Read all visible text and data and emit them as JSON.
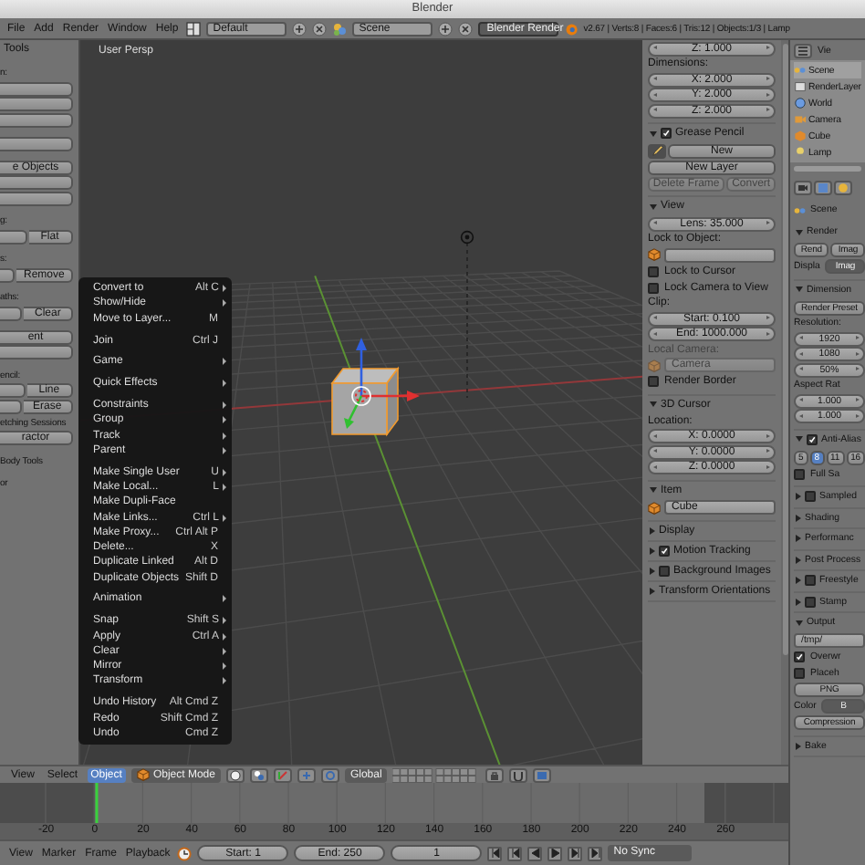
{
  "window": {
    "title": "Blender"
  },
  "menubar": {
    "menus": [
      "File",
      "Add",
      "Render",
      "Window",
      "Help"
    ],
    "layout": "Default",
    "scene": "Scene",
    "engine": "Blender Render",
    "stats": "v2.67 | Verts:8 | Faces:6 | Tris:12 | Objects:1/3 | Lamp"
  },
  "tool_shelf": {
    "title": "Tools",
    "groups": [
      {
        "items": [
          {
            "kind": "label",
            "label": "n:"
          },
          {
            "kind": "button"
          },
          {
            "kind": "button"
          },
          {
            "kind": "button"
          }
        ]
      },
      {
        "items": [
          {
            "kind": "button"
          }
        ]
      },
      {
        "items": [
          {
            "kind": "button",
            "label": "e Objects"
          },
          {
            "kind": "button"
          },
          {
            "kind": "button"
          }
        ]
      },
      {
        "items": [
          {
            "kind": "label",
            "label": "g:"
          },
          {
            "kind": "pair",
            "label": "Flat"
          }
        ]
      },
      {
        "items": [
          {
            "kind": "label",
            "label": "s:"
          },
          {
            "kind": "pair",
            "label": "Remove"
          }
        ]
      },
      {
        "items": [
          {
            "kind": "label",
            "label": "aths:"
          },
          {
            "kind": "pair",
            "label": "Clear"
          }
        ]
      },
      {
        "items": [
          {
            "kind": "button",
            "label": "ent"
          },
          {
            "kind": "button"
          }
        ]
      },
      {
        "items": [
          {
            "kind": "label",
            "label": "encil:"
          },
          {
            "kind": "pair",
            "label": "Line"
          },
          {
            "kind": "pair",
            "label": "Erase"
          },
          {
            "kind": "label",
            "label": "etching Sessions"
          },
          {
            "kind": "button",
            "label": "ractor"
          }
        ]
      },
      {
        "items": [
          {
            "kind": "label",
            "label": "Body Tools"
          }
        ]
      },
      {
        "items": [
          {
            "kind": "label",
            "label": "or"
          }
        ]
      }
    ]
  },
  "viewport": {
    "label": "User Persp"
  },
  "object_menu": {
    "sections": [
      [
        {
          "label": "Convert to",
          "shortcut": "Alt C",
          "submenu": true
        },
        {
          "label": "Show/Hide",
          "submenu": true
        },
        {
          "label": "Move to Layer...",
          "shortcut": "M",
          "submenu": false
        }
      ],
      [
        {
          "label": "Join",
          "shortcut": "Ctrl J",
          "submenu": false
        }
      ],
      [
        {
          "label": "Game",
          "submenu": true
        }
      ],
      [
        {
          "label": "Quick Effects",
          "submenu": true
        }
      ],
      [
        {
          "label": "Constraints",
          "submenu": true
        },
        {
          "label": "Group",
          "submenu": true
        },
        {
          "label": "Track",
          "submenu": true
        },
        {
          "label": "Parent",
          "submenu": true
        }
      ],
      [
        {
          "label": "Make Single User",
          "shortcut": "U",
          "submenu": true
        },
        {
          "label": "Make Local...",
          "shortcut": "L",
          "submenu": true
        },
        {
          "label": "Make Dupli-Face",
          "submenu": false
        },
        {
          "label": "Make Links...",
          "shortcut": "Ctrl L",
          "submenu": true
        },
        {
          "label": "Make Proxy...",
          "shortcut": "Ctrl Alt P",
          "submenu": false
        },
        {
          "label": "Delete...",
          "shortcut": "X",
          "submenu": false
        },
        {
          "label": "Duplicate Linked",
          "shortcut": "Alt D",
          "submenu": false
        },
        {
          "label": "Duplicate Objects",
          "shortcut": "Shift D",
          "submenu": false
        }
      ],
      [
        {
          "label": "Animation",
          "submenu": true
        }
      ],
      [
        {
          "label": "Snap",
          "shortcut": "Shift S",
          "submenu": true
        },
        {
          "label": "Apply",
          "shortcut": "Ctrl A",
          "submenu": true
        },
        {
          "label": "Clear",
          "submenu": true
        },
        {
          "label": "Mirror",
          "submenu": true
        },
        {
          "label": "Transform",
          "submenu": true
        }
      ],
      [
        {
          "label": "Undo History",
          "shortcut": "Alt Cmd Z",
          "submenu": false
        },
        {
          "label": "Redo",
          "shortcut": "Shift Cmd Z",
          "submenu": false
        },
        {
          "label": "Undo",
          "shortcut": "Cmd Z",
          "submenu": false
        }
      ]
    ]
  },
  "n_panel": {
    "panels": [
      {
        "items": [
          {
            "kind": "field",
            "value": "Z: 1.000"
          },
          {
            "kind": "label",
            "label": "Dimensions:"
          },
          {
            "kind": "field",
            "value": "X: 2.000"
          },
          {
            "kind": "field",
            "value": "Y: 2.000"
          },
          {
            "kind": "field",
            "value": "Z: 2.000"
          }
        ]
      },
      {
        "header": {
          "label": "Grease Pencil",
          "expanded": true,
          "checked": true
        },
        "items": [
          {
            "kind": "iconbutton",
            "label": "New"
          },
          {
            "kind": "button",
            "label": "New Layer"
          },
          {
            "kind": "buttons",
            "buttons": [
              {
                "label": "Delete Frame",
                "disabled": true
              },
              {
                "label": "Convert",
                "disabled": true
              }
            ]
          }
        ]
      },
      {
        "header": {
          "label": "View",
          "expanded": true
        },
        "items": [
          {
            "kind": "field",
            "value": "Lens: 35.000"
          },
          {
            "kind": "label",
            "label": "Lock to Object:"
          },
          {
            "kind": "object"
          },
          {
            "kind": "check",
            "label": "Lock to Cursor",
            "checked": false
          },
          {
            "kind": "check",
            "label": "Lock Camera to View",
            "checked": false
          },
          {
            "kind": "label",
            "label": "Clip:"
          },
          {
            "kind": "field",
            "value": "Start: 0.100"
          },
          {
            "kind": "field",
            "value": "End: 1000.000"
          },
          {
            "kind": "label",
            "label": "Local Camera:",
            "disabled": true
          },
          {
            "kind": "object",
            "value": "Camera",
            "disabled": true
          },
          {
            "kind": "check",
            "label": "Render Border",
            "checked": false
          }
        ]
      },
      {
        "header": {
          "label": "3D Cursor",
          "expanded": true
        },
        "items": [
          {
            "kind": "label",
            "label": "Location:"
          },
          {
            "kind": "field",
            "value": "X: 0.0000"
          },
          {
            "kind": "field",
            "value": "Y: 0.0000"
          },
          {
            "kind": "field",
            "value": "Z: 0.0000"
          }
        ]
      },
      {
        "header": {
          "label": "Item",
          "expanded": true
        },
        "items": [
          {
            "kind": "object",
            "value": "Cube"
          }
        ]
      },
      {
        "header": {
          "label": "Display",
          "expanded": false
        }
      },
      {
        "header": {
          "label": "Motion Tracking",
          "expanded": false,
          "checked": true
        }
      },
      {
        "header": {
          "label": "Background Images",
          "expanded": false,
          "checked": false
        }
      },
      {
        "header": {
          "label": "Transform Orientations",
          "expanded": false
        }
      }
    ]
  },
  "view3d_header": {
    "menus": [
      {
        "label": "View",
        "selected": false
      },
      {
        "label": "Select",
        "selected": false
      },
      {
        "label": "Object",
        "selected": true
      }
    ],
    "mode": "Object Mode",
    "orientation": "Global"
  },
  "timeline": {
    "ruler": [
      "-20",
      "0",
      "20",
      "40",
      "60",
      "80",
      "100",
      "120",
      "140",
      "160",
      "180",
      "200",
      "220",
      "240",
      "260"
    ]
  },
  "timeline_header": {
    "menus": [
      "View",
      "Marker",
      "Frame",
      "Playback"
    ],
    "start": "Start: 1",
    "end": "End: 250",
    "frame": "1",
    "sync": "No Sync"
  },
  "properties": {
    "header": "Vie",
    "outliner": [
      "Scene",
      "RenderLayer",
      "World",
      "Camera",
      "Cube",
      "Lamp"
    ],
    "breadcrumb": "Scene",
    "panels": [
      {
        "header": {
          "label": "Render",
          "expanded": true
        },
        "items": [
          {
            "kind": "buttons",
            "buttons": [
              {
                "label": "Rend"
              },
              {
                "label": "Imag"
              }
            ]
          },
          {
            "kind": "labelled",
            "label": "Displa",
            "buttons": [
              {
                "label": "Imag"
              }
            ]
          }
        ]
      },
      {
        "header": {
          "label": "Dimension",
          "expanded": true
        },
        "items": [
          {
            "kind": "button",
            "label": "Render Preset"
          },
          {
            "kind": "label",
            "label": "Resolution:"
          },
          {
            "kind": "field",
            "value": "1920"
          },
          {
            "kind": "field",
            "value": "1080"
          },
          {
            "kind": "field",
            "value": "50%"
          },
          {
            "kind": "label",
            "label": "Aspect Rat"
          },
          {
            "kind": "field",
            "value": "1.000"
          },
          {
            "kind": "field",
            "value": "1.000"
          }
        ]
      },
      {
        "header": {
          "label": "Anti-Alias",
          "expanded": true,
          "checked": true
        },
        "items": [
          {
            "kind": "buttons",
            "buttons": [
              {
                "label": "5",
                "selected": false
              },
              {
                "label": "8",
                "selected": true
              },
              {
                "label": "11",
                "selected": false
              },
              {
                "label": "16",
                "selected": false
              }
            ]
          },
          {
            "kind": "check",
            "label": "Full Sa",
            "checked": false
          }
        ]
      },
      {
        "header": {
          "label": "Sampled",
          "expanded": false,
          "checked": false
        }
      },
      {
        "header": {
          "label": "Shading",
          "expanded": false
        }
      },
      {
        "header": {
          "label": "Performanc",
          "expanded": false
        }
      },
      {
        "header": {
          "label": "Post Process",
          "expanded": false
        }
      },
      {
        "header": {
          "label": "Freestyle",
          "expanded": false,
          "checked": false
        }
      },
      {
        "header": {
          "label": "Stamp",
          "expanded": false,
          "checked": false
        }
      },
      {
        "header": {
          "label": "Output",
          "expanded": true
        },
        "items": [
          {
            "kind": "text",
            "value": "/tmp/"
          },
          {
            "kind": "check",
            "label": "Overwr",
            "checked": true
          },
          {
            "kind": "check",
            "label": "Placeh",
            "checked": false
          },
          {
            "kind": "button",
            "label": "PNG"
          },
          {
            "kind": "labelled",
            "label": "Color",
            "buttons": [
              {
                "label": "B",
                "selected": true
              }
            ]
          },
          {
            "kind": "button",
            "label": "Compression"
          }
        ]
      },
      {
        "header": {
          "label": "Bake",
          "expanded": false
        }
      }
    ]
  }
}
